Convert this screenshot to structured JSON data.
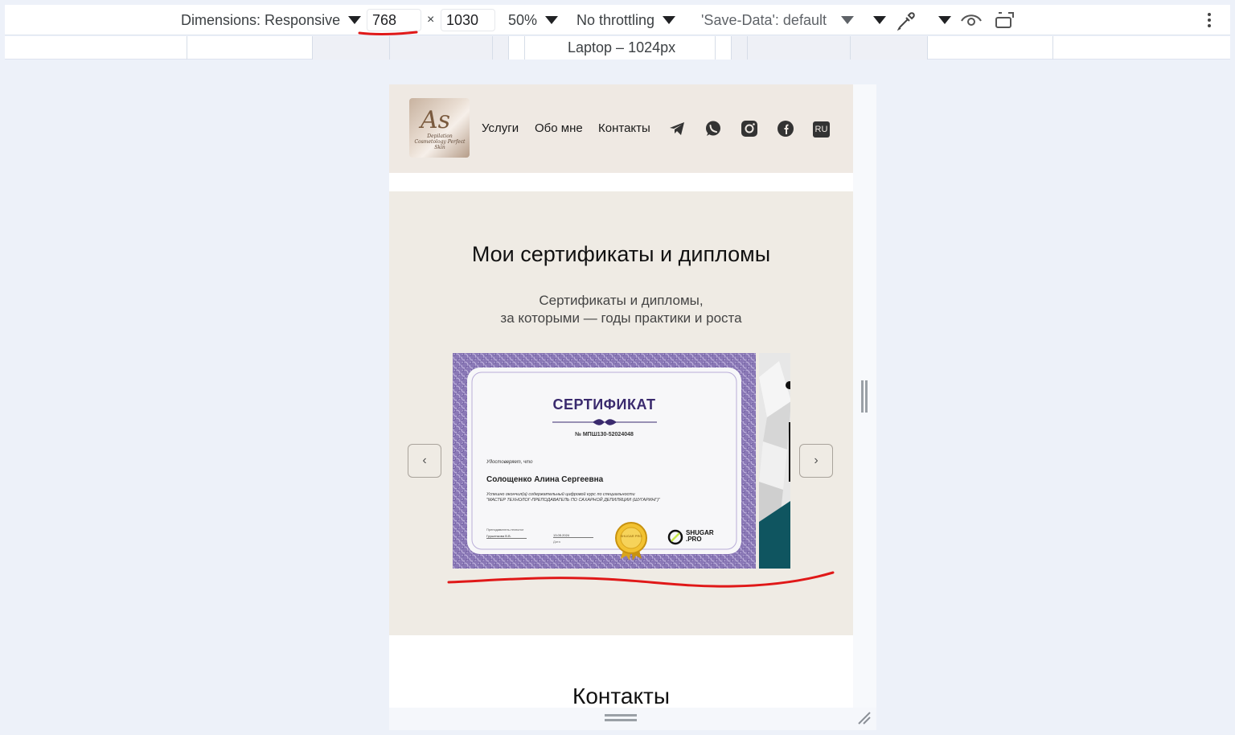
{
  "devtools": {
    "dimensions_label": "Dimensions: Responsive",
    "width_value": "768",
    "times": "×",
    "height_value": "1030",
    "zoom": "50%",
    "throttling": "No throttling",
    "save_data": "'Save-Data': default",
    "media_query_label": "Laptop – 1024px"
  },
  "site": {
    "logo_mark": "As",
    "logo_tagline": "Depilation Cosmetology Perfect Skin",
    "nav": [
      "Услуги",
      "Обо мне",
      "Контакты"
    ],
    "social_icons": [
      "telegram-icon",
      "whatsapp-icon",
      "instagram-icon",
      "facebook-icon"
    ],
    "lang": "RU"
  },
  "certificates": {
    "title": "Мои сертификаты и дипломы",
    "subtitle_line1": "Сертификаты и дипломы,",
    "subtitle_line2": "за которыми — годы практики и роста",
    "prev_label": "‹",
    "next_label": "›",
    "card": {
      "heading": "СЕРТИФИКАТ",
      "number": "№ МПШ130-52024048",
      "certifies": "Удостоверяет, что",
      "name": "Солощенко Алина Сергеевна",
      "text_line1": "Успешно окончил(а) содержательный цифровой курс по специальности",
      "text_line2": "\"МАСТЕР ТЕХНОЛОГ-ПРЕПОДАВАТЕЛЬ ПО САХАРНОЙ ДЕПИЛЯЦИИ (ШУГАРИНГ)\"",
      "signer_role": "Преподаватель-технолог",
      "signer_name": "Грушенкова В.В.",
      "date": "13.05.2024",
      "date_caption": "Дата",
      "seal_text": "SHUGAR PRO",
      "brand_line1": "SHUGAR",
      "brand_line2": ".PRO"
    }
  },
  "contacts": {
    "title": "Контакты"
  },
  "colors": {
    "annotation_red": "#e01818",
    "section_bg": "#efebe4",
    "cert_border": "#7b68a8",
    "cert_heading": "#3a2a6e"
  }
}
